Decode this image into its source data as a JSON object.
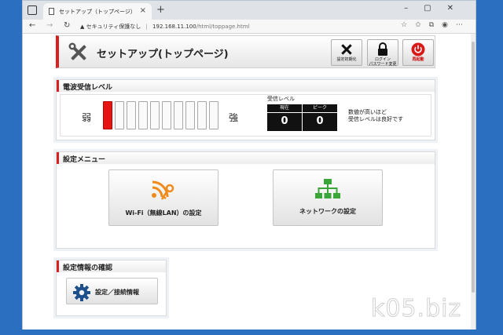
{
  "browser": {
    "tab_title": "セットアップ（トップページ）",
    "tab_close": "×",
    "new_tab": "+",
    "security_label": "セキュリティ保護なし",
    "url_host": "192.168.11.100",
    "url_path": "/html/toppage.html"
  },
  "header": {
    "title": "セットアップ(トップページ)",
    "buttons": [
      {
        "label": "設定初期化",
        "icon": "tools-icon"
      },
      {
        "label_line1": "ログイン",
        "label_line2": "パスワード変更",
        "icon": "lock-icon"
      },
      {
        "label": "再起動",
        "icon": "power-icon"
      }
    ]
  },
  "signal": {
    "section_title": "電波受信レベル",
    "weak_label": "弱",
    "strong_label": "強",
    "bar_count": 10,
    "active_bars": 1,
    "level_caption": "受信レベル",
    "current_label": "現在",
    "current_value": "0",
    "peak_label": "ピーク",
    "peak_value": "0",
    "note_line1": "数値が高いほど",
    "note_line2": "受信レベルは良好です"
  },
  "menu": {
    "section_title": "設定メニュー",
    "wifi_label": "Wi-Fi（無線LAN）の設定",
    "network_label": "ネットワークの設定"
  },
  "info": {
    "section_title": "設定情報の確認",
    "button_label": "設定／接続情報"
  },
  "watermark": "k05.biz",
  "colors": {
    "accent_red": "#d92020",
    "bar_active": "#e51414",
    "wifi_orange": "#f08a1a",
    "network_green": "#3aa63a",
    "gear_blue": "#1c4f8c",
    "background_blue": "#2a6fc0"
  }
}
